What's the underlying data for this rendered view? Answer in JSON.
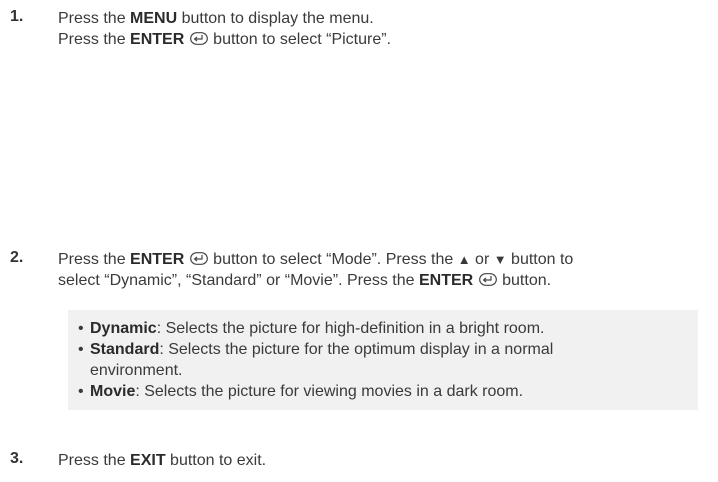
{
  "steps": [
    {
      "number": "1.",
      "line1": {
        "pre": "Press the ",
        "bold": "MENU",
        "post": " button to display the menu."
      },
      "line2": {
        "pre": "Press the ",
        "bold": "ENTER",
        "post": " button to select “Picture”."
      }
    },
    {
      "number": "2.",
      "line1": {
        "pre": "Press the ",
        "bold": "ENTER",
        "mid": " button to select “Mode”. Press the ",
        "up": "▲",
        "or": " or ",
        "down": "▼",
        "post": " button to"
      },
      "line2": {
        "pre": "select “Dynamic”, “Standard” or “Movie”. Press the ",
        "bold": "ENTER",
        "post": " button."
      }
    },
    {
      "number": "3.",
      "line1": {
        "pre": "Press the ",
        "bold": "EXIT",
        "post": " button to exit."
      }
    }
  ],
  "modes": [
    {
      "name": "Dynamic",
      "desc": ": Selects the picture for high-definition in a bright room."
    },
    {
      "name": "Standard",
      "desc": ": Selects the picture for the optimum display in a normal",
      "desc2": "environment."
    },
    {
      "name": "Movie",
      "desc": ": Selects the picture for viewing movies in a dark room."
    }
  ],
  "bullet_char": "•",
  "icons": {
    "enter": "enter-return-icon"
  }
}
